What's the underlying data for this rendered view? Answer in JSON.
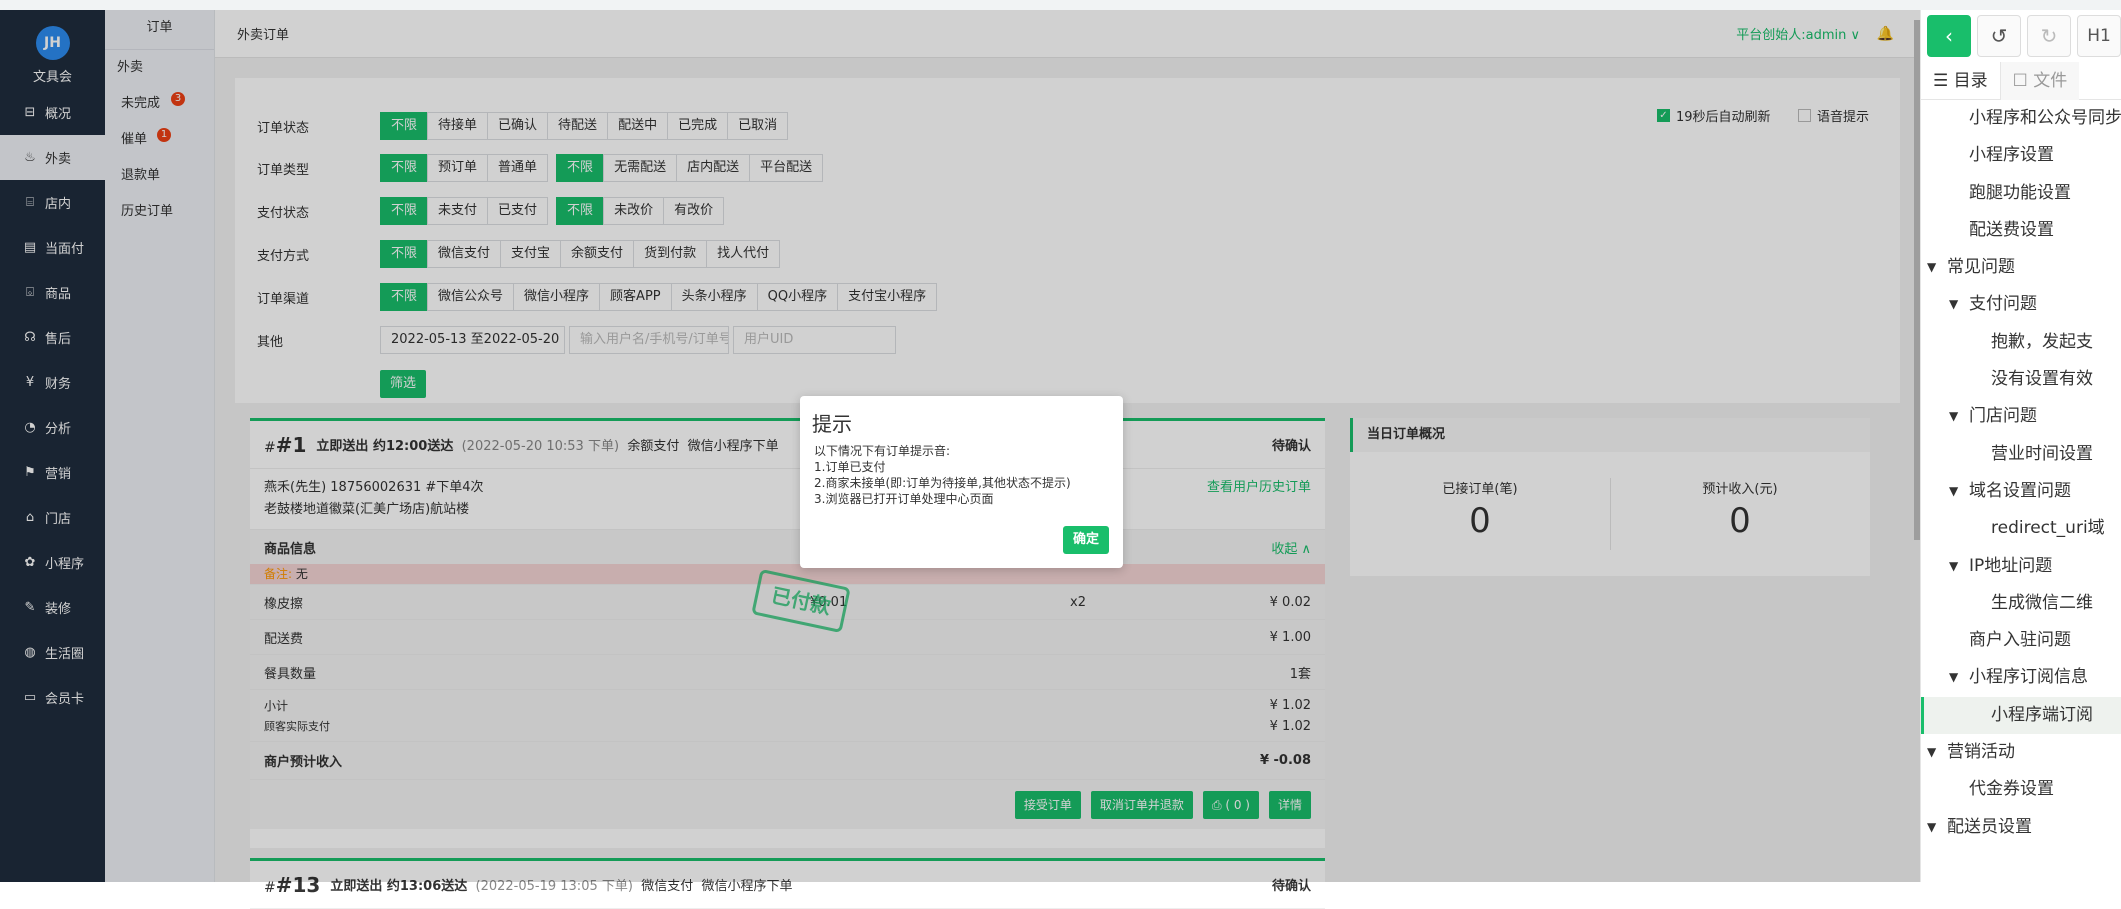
{
  "brand": {
    "name": "文具会",
    "logo_text": "JH"
  },
  "main_nav": [
    {
      "label": "概况",
      "icon": "dashboard-icon",
      "glyph": "⊟"
    },
    {
      "label": "外卖",
      "icon": "delivery-icon",
      "glyph": "♨"
    },
    {
      "label": "店内",
      "icon": "store-icon",
      "glyph": "⌸"
    },
    {
      "label": "当面付",
      "icon": "receipt-icon",
      "glyph": "▤"
    },
    {
      "label": "商品",
      "icon": "bag-icon",
      "glyph": "⌺"
    },
    {
      "label": "售后",
      "icon": "service-icon",
      "glyph": "☊"
    },
    {
      "label": "财务",
      "icon": "money-icon",
      "glyph": "¥"
    },
    {
      "label": "分析",
      "icon": "analytics-icon",
      "glyph": "◔"
    },
    {
      "label": "营销",
      "icon": "flag-icon",
      "glyph": "⚑"
    },
    {
      "label": "门店",
      "icon": "shop-icon",
      "glyph": "⌂"
    },
    {
      "label": "小程序",
      "icon": "miniprogram-icon",
      "glyph": "✿"
    },
    {
      "label": "装修",
      "icon": "brush-icon",
      "glyph": "✎"
    },
    {
      "label": "生活圈",
      "icon": "globe-icon",
      "glyph": "◍"
    },
    {
      "label": "会员卡",
      "icon": "card-icon",
      "glyph": "▭"
    }
  ],
  "sub_nav": {
    "header": "订单",
    "group": "外卖",
    "items": [
      {
        "label": "未完成",
        "badge": "3"
      },
      {
        "label": "催单",
        "badge": "1"
      },
      {
        "label": "退款单",
        "badge": ""
      },
      {
        "label": "历史订单",
        "badge": ""
      }
    ]
  },
  "topbar": {
    "title": "外卖订单",
    "admin": "平台创始人:admin ∨",
    "bell": "🔔"
  },
  "filters": {
    "status": {
      "label": "订单状态",
      "options": [
        "不限",
        "待接单",
        "已确认",
        "待配送",
        "配送中",
        "已完成",
        "已取消"
      ]
    },
    "type": {
      "label": "订单类型",
      "options_a": [
        "不限",
        "预订单",
        "普通单"
      ],
      "options_b": [
        "不限",
        "无需配送",
        "店内配送",
        "平台配送"
      ]
    },
    "pay_status": {
      "label": "支付状态",
      "options_a": [
        "不限",
        "未支付",
        "已支付"
      ],
      "options_b": [
        "不限",
        "未改价",
        "有改价"
      ]
    },
    "pay_method": {
      "label": "支付方式",
      "options": [
        "不限",
        "微信支付",
        "支付宝",
        "余额支付",
        "货到付款",
        "找人代付"
      ]
    },
    "channel": {
      "label": "订单渠道",
      "options": [
        "不限",
        "微信公众号",
        "微信小程序",
        "顾客APP",
        "头条小程序",
        "QQ小程序",
        "支付宝小程序"
      ]
    },
    "other": {
      "label": "其他",
      "date_range": "2022-05-13 至2022-05-20",
      "user_placeholder": "输入用户名/手机号/订单号",
      "uid_placeholder": "用户UID"
    },
    "submit": "筛选",
    "auto_refresh": "19秒后自动刷新",
    "voice": "语音提示"
  },
  "order1": {
    "num": "#1",
    "desc": "立即送出 约12:00送达",
    "time": "(2022-05-20 10:53 下单)",
    "pay": "余额支付",
    "source": "微信小程序下单",
    "status": "待确认",
    "customer": "燕禾(先生) 18756002631 #下单4次",
    "address": "老鼓楼地道徽菜(汇美广场店)航站楼",
    "history_link": "查看用户历史订单",
    "goods_header": "商品信息",
    "collapse": "收起 ∧",
    "note_tag": "备注:",
    "note": "无",
    "item_name": "橡皮擦",
    "item_price": "¥0.01",
    "item_qty": "x2",
    "item_total": "¥ 0.02",
    "delivery_label": "配送费",
    "delivery_value": "¥ 1.00",
    "tableware_label": "餐具数量",
    "tableware_value": "1套",
    "subtotal_label": "小计",
    "subtotal_value": "¥ 1.02",
    "paid_label": "顾客实际支付",
    "paid_value": "¥ 1.02",
    "income_label": "商户预计收入",
    "income_value": "¥ -0.08",
    "stamp": "已付款",
    "actions": [
      "接受订单",
      "取消订单并退款",
      "⎙ ( 0 )",
      "详情"
    ]
  },
  "order2": {
    "num": "#13",
    "desc": "立即送出 约13:06送达",
    "time": "(2022-05-19 13:05 下单)",
    "pay": "微信支付",
    "source": "微信小程序下单",
    "status": "待确认"
  },
  "today": {
    "title": "当日订单概况",
    "accepted_label": "已接订单(笔)",
    "accepted_value": "0",
    "income_label": "预计收入(元)",
    "income_value": "0"
  },
  "modal": {
    "title": "提示",
    "lines": [
      "以下情况下有订单提示音:",
      "1.订单已支付",
      "2.商家未接单(即:订单为待接单,其他状态不提示)",
      "3.浏览器已打开订单处理中心页面"
    ],
    "ok": "确定"
  },
  "right_pane": {
    "tab_toc": "☰ 目录",
    "tab_file": "☐ 文件",
    "toolbar": [
      "‹",
      "↺",
      "↻",
      "H1"
    ],
    "toc": [
      {
        "label": "小程序和公众号同步数",
        "level": 1,
        "caret": false
      },
      {
        "label": "小程序设置",
        "level": 1,
        "caret": false
      },
      {
        "label": "跑腿功能设置",
        "level": 1,
        "caret": false
      },
      {
        "label": "配送费设置",
        "level": 1,
        "caret": false
      },
      {
        "label": "常见问题",
        "level": 0,
        "caret": true
      },
      {
        "label": "支付问题",
        "level": 1,
        "caret": true
      },
      {
        "label": "抱歉，发起支",
        "level": 2,
        "caret": false
      },
      {
        "label": "没有设置有效",
        "level": 2,
        "caret": false
      },
      {
        "label": "门店问题",
        "level": 1,
        "caret": true
      },
      {
        "label": "营业时间设置",
        "level": 2,
        "caret": false
      },
      {
        "label": "域名设置问题",
        "level": 1,
        "caret": true
      },
      {
        "label": "redirect_uri域",
        "level": 2,
        "caret": false
      },
      {
        "label": "IP地址问题",
        "level": 1,
        "caret": true
      },
      {
        "label": "生成微信二维",
        "level": 2,
        "caret": false
      },
      {
        "label": "商户入驻问题",
        "level": 1,
        "caret": false
      },
      {
        "label": "小程序订阅信息",
        "level": 1,
        "caret": true
      },
      {
        "label": "小程序端订阅",
        "level": 2,
        "caret": false,
        "active": true
      },
      {
        "label": "营销活动",
        "level": 0,
        "caret": true
      },
      {
        "label": "代金券设置",
        "level": 1,
        "caret": false
      },
      {
        "label": "配送员设置",
        "level": 0,
        "caret": true
      }
    ]
  },
  "colors": {
    "accent": "#19be6b",
    "sidebar": "#1f2d3d",
    "danger": "#ed4014"
  }
}
